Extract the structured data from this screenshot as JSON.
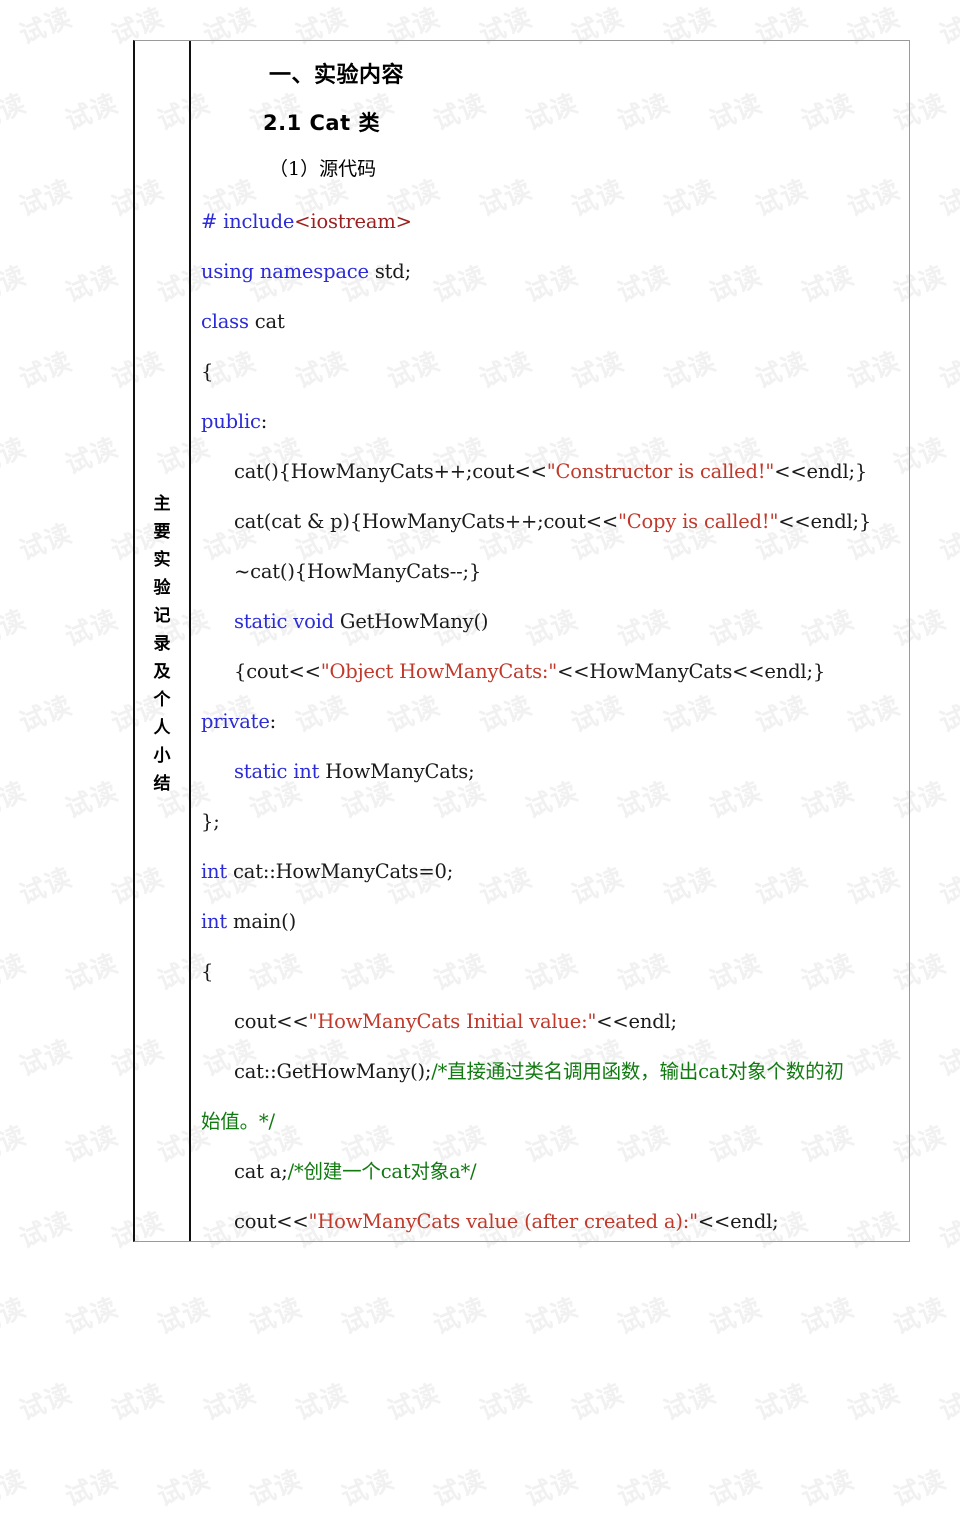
{
  "document": {
    "watermark_text": "试读",
    "watermark_color": "#f1f1f1",
    "sidebar_label_chars": [
      "主",
      "要",
      "实",
      "验",
      "记",
      "录",
      "及",
      "个",
      "人",
      "小",
      "结"
    ],
    "sidebar_label_full": "主要实验记录及个人小结"
  },
  "headings": {
    "section": "一、实验内容",
    "subsection": "2.1 Cat 类",
    "item": "（1）源代码"
  },
  "colors": {
    "keyword": "#2b2bd8",
    "string": "#c0392b",
    "comment": "#107a10",
    "include": "#9c1f1f",
    "text": "#1a1a1a"
  },
  "code": {
    "language": "cpp",
    "lines": [
      {
        "indent": 0,
        "tokens": [
          {
            "t": "# include",
            "c": "kw"
          },
          {
            "t": "<iostream>",
            "c": "inc"
          }
        ]
      },
      {
        "indent": 0,
        "tokens": [
          {
            "t": "using namespace",
            "c": "kw"
          },
          {
            "t": " std;",
            "c": "plain"
          }
        ]
      },
      {
        "indent": 0,
        "tokens": [
          {
            "t": "class",
            "c": "kw"
          },
          {
            "t": " cat",
            "c": "plain"
          }
        ]
      },
      {
        "indent": 0,
        "tokens": [
          {
            "t": "{",
            "c": "plain"
          }
        ]
      },
      {
        "indent": 0,
        "tokens": [
          {
            "t": "public",
            "c": "kw"
          },
          {
            "t": ":",
            "c": "plain"
          }
        ]
      },
      {
        "indent": 1,
        "tokens": [
          {
            "t": "cat(){HowManyCats++;cout<<",
            "c": "plain"
          },
          {
            "t": "\"Constructor is called!\"",
            "c": "str"
          },
          {
            "t": "<<endl;}",
            "c": "plain"
          }
        ]
      },
      {
        "indent": 1,
        "tokens": [
          {
            "t": "cat(cat & p){HowManyCats++;cout<<",
            "c": "plain"
          },
          {
            "t": "\"Copy is called!\"",
            "c": "str"
          },
          {
            "t": "<<endl;}",
            "c": "plain"
          }
        ]
      },
      {
        "indent": 1,
        "tokens": [
          {
            "t": "~cat(){HowManyCats--;}",
            "c": "plain"
          }
        ]
      },
      {
        "indent": 1,
        "tokens": [
          {
            "t": "static void",
            "c": "kw"
          },
          {
            "t": " GetHowMany()",
            "c": "plain"
          }
        ]
      },
      {
        "indent": 1,
        "tokens": [
          {
            "t": "{cout<<",
            "c": "plain"
          },
          {
            "t": "\"Object HowManyCats:\"",
            "c": "str"
          },
          {
            "t": "<<HowManyCats<<endl;}",
            "c": "plain"
          }
        ]
      },
      {
        "indent": 0,
        "tokens": [
          {
            "t": "private",
            "c": "kw"
          },
          {
            "t": ":",
            "c": "plain"
          }
        ]
      },
      {
        "indent": 1,
        "tokens": [
          {
            "t": "static int",
            "c": "kw"
          },
          {
            "t": " HowManyCats;",
            "c": "plain"
          }
        ]
      },
      {
        "indent": 0,
        "tokens": [
          {
            "t": "};",
            "c": "plain"
          }
        ]
      },
      {
        "indent": 0,
        "tokens": [
          {
            "t": "int",
            "c": "kw"
          },
          {
            "t": " cat::HowManyCats=0;",
            "c": "plain"
          }
        ]
      },
      {
        "indent": 0,
        "tokens": [
          {
            "t": "int",
            "c": "kw"
          },
          {
            "t": " main()",
            "c": "plain"
          }
        ]
      },
      {
        "indent": 0,
        "tokens": [
          {
            "t": "{",
            "c": "plain"
          }
        ]
      },
      {
        "indent": 1,
        "tokens": [
          {
            "t": "cout<<",
            "c": "plain"
          },
          {
            "t": "\"HowManyCats Initial value:\"",
            "c": "str"
          },
          {
            "t": "<<endl;",
            "c": "plain"
          }
        ]
      },
      {
        "indent": 1,
        "tokens": [
          {
            "t": "cat::GetHowMany();",
            "c": "plain"
          },
          {
            "t": "/*直接通过类名调用函数，输出cat对象个数的初",
            "c": "cmt"
          }
        ]
      },
      {
        "indent": 0,
        "tokens": [
          {
            "t": "始值。*/",
            "c": "cmt"
          }
        ]
      },
      {
        "indent": 1,
        "tokens": [
          {
            "t": "cat a;",
            "c": "plain"
          },
          {
            "t": "/*创建一个cat对象a*/",
            "c": "cmt"
          }
        ]
      },
      {
        "indent": 1,
        "tokens": [
          {
            "t": "cout<<",
            "c": "plain"
          },
          {
            "t": "\"HowManyCats value (after created a):\"",
            "c": "str"
          },
          {
            "t": "<<endl;",
            "c": "plain"
          }
        ]
      }
    ]
  }
}
